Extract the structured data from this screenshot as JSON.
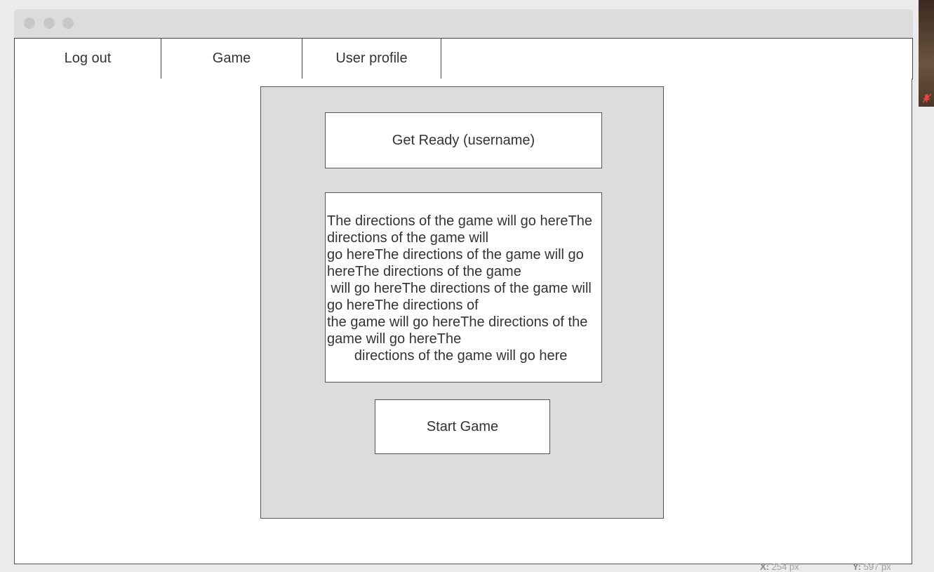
{
  "nav": {
    "items": [
      {
        "label": "Log out"
      },
      {
        "label": "Game"
      },
      {
        "label": "User profile"
      }
    ]
  },
  "game": {
    "ready_label": "Get Ready (username)",
    "directions_text": "The directions of the game will go hereThe\ndirections of the game will\ngo hereThe directions of the game will go\nhereThe directions of the game\n will go hereThe directions of the game will\ngo hereThe directions of\nthe game will go hereThe directions of the\ngame will go hereThe\n       directions of the game will go here",
    "start_button_label": "Start Game"
  },
  "status": {
    "x_label": "X:",
    "x_value": "254 px",
    "y_label": "Y:",
    "y_value": "597 px"
  },
  "colors": {
    "panel_bg": "#dcdcdc",
    "border": "#555555",
    "text": "#333333"
  }
}
